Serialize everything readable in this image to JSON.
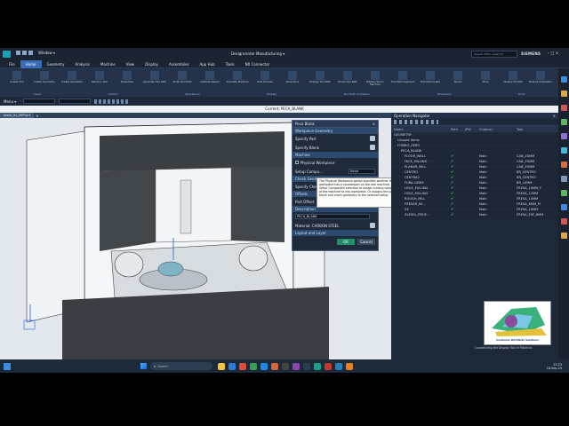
{
  "window": {
    "title": "Designcenter  Manufacturing ▾",
    "search_placeholder": "Search 2D5+ (search)",
    "brand": "SIEMENS",
    "window_menu": "Window ▾",
    "menu_label": "Menu ▾"
  },
  "menu": [
    "File",
    "Home",
    "Geometry",
    "Analysis",
    "Machine",
    "View",
    "Display",
    "Assemblies",
    "App Hub",
    "Tools",
    "NX Connector"
  ],
  "menu_active": 1,
  "ribbon": {
    "groups": [
      "Insert",
      "Actions",
      "Operations",
      "Display",
      "Tool Path Animation",
      "Workpiece",
      "Tools"
    ],
    "buttons": [
      "Create Tool",
      "Create Geometry",
      "Create Operation",
      "Machine Tool",
      "Properties",
      "Generate Tool Path",
      "Verify Tool Path",
      "Validate Report",
      "Simulate Machine",
      "Post Process",
      "Shop Docs",
      "Display Tool Path",
      "Orient Tool Path",
      "Display Tool in Machine",
      "Tool Path Segment",
      "Tool Path Graph",
      "Speed",
      "More",
      "Display 3D IPW",
      "Feature Simulation"
    ]
  },
  "command_line": "Current: PECA_BLANK",
  "viewport_tab": "teste_5x_MFP.prt",
  "dialog": {
    "title": "Peca Blank",
    "sections": {
      "workpiece_geometry": "Workpiece Geometry",
      "machine": "Machine",
      "check_geometry": "Check Geom...",
      "offsets": "Offsets",
      "description": "Description",
      "layout": "Layout and Layer"
    },
    "labels": {
      "specify_part": "Specify Part",
      "specify_blank": "Specify Blank",
      "physical_workpiece": "Physical Workpiece",
      "setup_component": "Setup Compo...",
      "specify_check": "Specify Check",
      "part_offset": "Part Offset",
      "material": "Material: CARBON STEEL"
    },
    "setup_value": "None",
    "part_offset_value": "0.0000",
    "description_value": "PECA_BLANK",
    "ok": "OK",
    "cancel": "Cancel",
    "tooltip": "The Physical Workpiece option specifies whether this workpiece has a counterpart on the real machine. Use the Setup Component selection to assign a setup component of the machine to this workpiece. Or assigns the part, blank and check geometry to the selected setup."
  },
  "opnav": {
    "title": "Operation Navigator",
    "columns": [
      "Name",
      "Path",
      "IPW",
      "Channel",
      "Tool"
    ],
    "tree": [
      {
        "name": "GEOMETRY",
        "level": 0,
        "path": "",
        "ipw": "",
        "channel": "",
        "tool": ""
      },
      {
        "name": "Unused Items",
        "level": 1,
        "path": "",
        "ipw": "",
        "channel": "",
        "tool": ""
      },
      {
        "name": "FOMRO_ZERO",
        "level": 1,
        "path": "",
        "ipw": "",
        "channel": "",
        "tool": ""
      },
      {
        "name": "PECA_BLANK",
        "level": 2,
        "path": "",
        "ipw": "",
        "channel": "",
        "tool": ""
      },
      {
        "name": "FLOOR_WALL",
        "level": 3,
        "path": "✔",
        "ipw": "",
        "channel": "Main",
        "tool": "CAB_ZSMM"
      },
      {
        "name": "FACE_MILLING",
        "level": 3,
        "path": "✔",
        "ipw": "",
        "channel": "Main",
        "tool": "CAB_ZSMM"
      },
      {
        "name": "PLANAR_MILL",
        "level": 3,
        "path": "✔",
        "ipw": "",
        "channel": "Main",
        "tool": "CAB_ZSMM"
      },
      {
        "name": "CENTRO",
        "level": 3,
        "path": "✔",
        "ipw": "",
        "channel": "Main",
        "tool": "BR_CENTRO"
      },
      {
        "name": "CENTRA2",
        "level": 3,
        "path": "✔",
        "ipw": "",
        "channel": "Main",
        "tool": "BR_CENTRO"
      },
      {
        "name": "FURA-10MM",
        "level": 3,
        "path": "✔",
        "ipw": "",
        "channel": "Main",
        "tool": "BR_10MM"
      },
      {
        "name": "HOLE_MILLING",
        "level": 3,
        "path": "✔",
        "ipw": "",
        "channel": "Main",
        "tool": "FRESA_10MM_F"
      },
      {
        "name": "HOLE_MILLING",
        "level": 3,
        "path": "✔",
        "ipw": "",
        "channel": "Main",
        "tool": "FRESA_12MM"
      },
      {
        "name": "ROUGH_MILL",
        "level": 3,
        "path": "✔",
        "ipw": "",
        "channel": "Main",
        "tool": "FRESA_10MM"
      },
      {
        "name": "FRESAR_MI...",
        "level": 3,
        "path": "✔",
        "ipw": "",
        "channel": "Main",
        "tool": "FRESA_6MM_M"
      },
      {
        "name": "5X",
        "level": 3,
        "path": "✔",
        "ipw": "",
        "channel": "Main",
        "tool": "FRESA_10MM"
      },
      {
        "name": "ZLEVEL_PROF...",
        "level": 3,
        "path": "✔",
        "ipw": "",
        "channel": "Main",
        "tool": "FRESA_ESF_8MM"
      }
    ]
  },
  "watermark": {
    "text": "Costumes WorkNote Solutions"
  },
  "footer_note": "Customizing the Display Tool in Machine.",
  "taskbar": {
    "search_placeholder": "Search",
    "time": "22:23",
    "date": "18-Sep-24"
  },
  "colors": {
    "accent": "#3a6db6",
    "ok_button": "#1f8f6a",
    "check_green": "#4fd36a",
    "cyan_readout": "#00b7ff"
  }
}
